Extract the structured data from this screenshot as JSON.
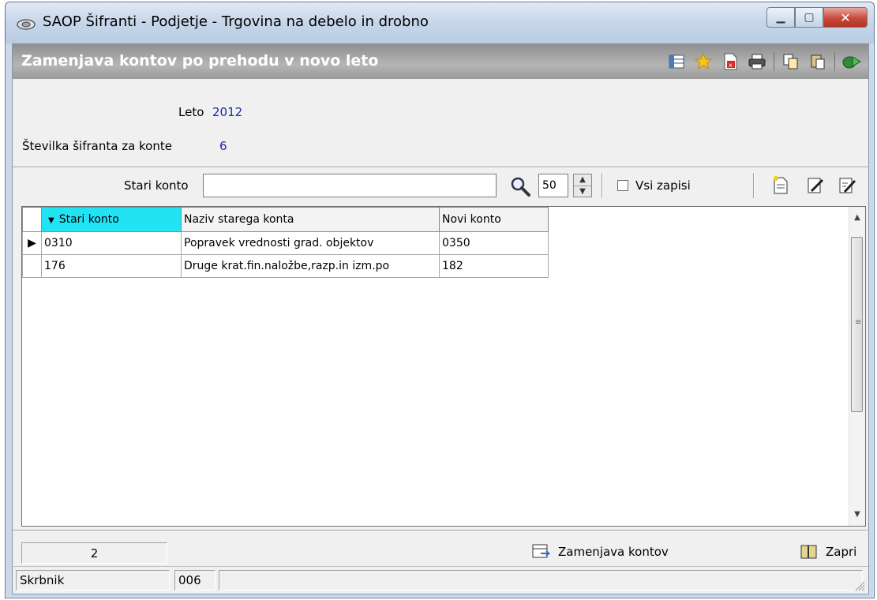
{
  "window": {
    "title": "SAOP Šifranti - Podjetje - Trgovina na debelo in drobno"
  },
  "form": {
    "title": "Zamenjava kontov po prehodu v novo leto"
  },
  "fields": {
    "leto_label": "Leto",
    "leto_value": "2012",
    "stevilka_label": "Številka šifranta za konte",
    "stevilka_value": "6"
  },
  "search": {
    "label": "Stari konto",
    "value": "",
    "limit": "50",
    "vsi_zapisi_label": "Vsi zapisi",
    "vsi_zapisi_checked": false
  },
  "table": {
    "columns": [
      "Stari konto",
      "Naziv starega konta",
      "Novi konto"
    ],
    "sorted_column": "Stari konto",
    "rows": [
      {
        "stari": "0310",
        "naziv": "Popravek vrednosti grad.  objektov",
        "novi": "0350",
        "current": true
      },
      {
        "stari": "176",
        "naziv": "Druge krat.fin.naložbe,razp.in izm.po",
        "novi": "182",
        "current": false
      }
    ]
  },
  "footer": {
    "record_count": "2",
    "replace_button": "Zamenjava kontov",
    "close_button": "Zapri"
  },
  "statusbar": {
    "user": "Skrbnik",
    "code": "006",
    "extra": ""
  },
  "colors": {
    "sorted_header": "#22e3f3",
    "value_text": "#1c2ca8",
    "form_titlebar": "#9a9a9a"
  }
}
